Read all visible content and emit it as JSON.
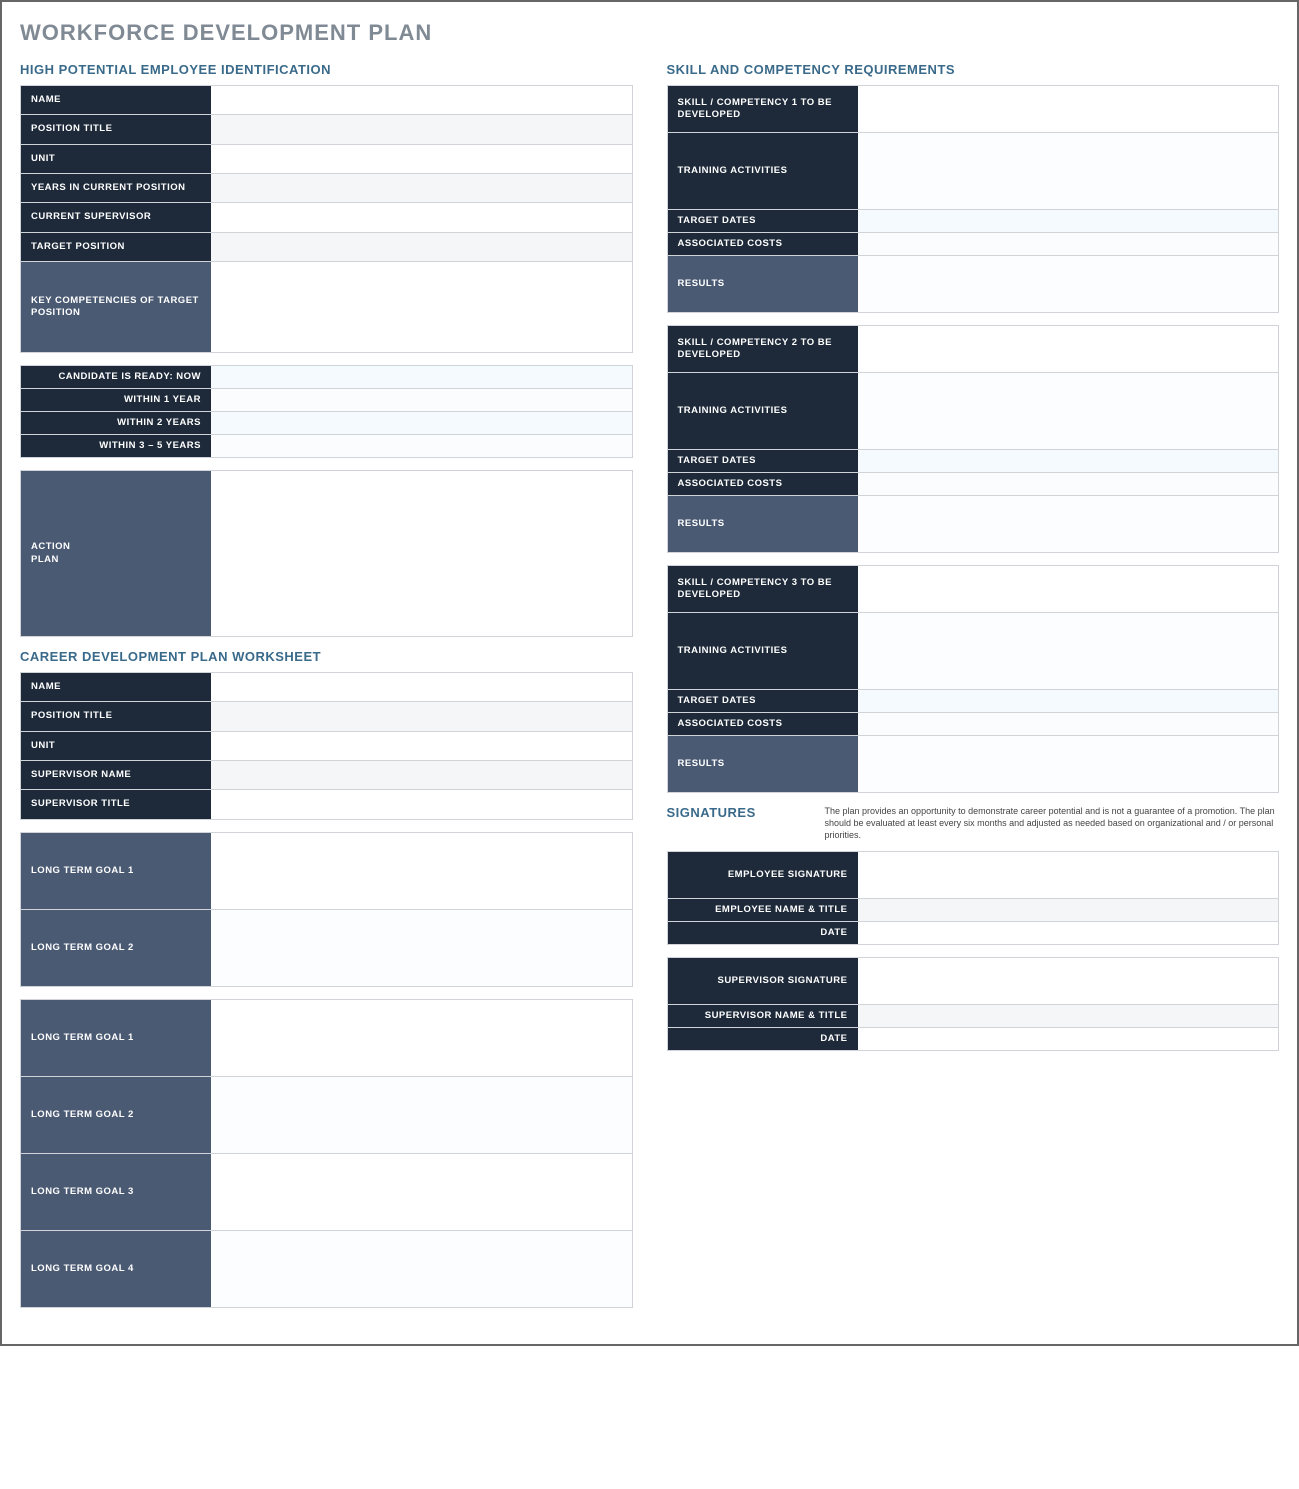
{
  "title": "WORKFORCE DEVELOPMENT PLAN",
  "left": {
    "hp_heading": "HIGH POTENTIAL EMPLOYEE IDENTIFICATION",
    "hp": {
      "name": "NAME",
      "position_title": "POSITION TITLE",
      "unit": "UNIT",
      "years": "YEARS IN CURRENT POSITION",
      "supervisor": "CURRENT SUPERVISOR",
      "target_position": "TARGET POSITION",
      "key_comp": "KEY COMPETENCIES OF TARGET POSITION"
    },
    "ready": {
      "now": "CANDIDATE IS READY:  NOW",
      "y1": "WITHIN 1 YEAR",
      "y2": "WITHIN 2 YEARS",
      "y35": "WITHIN 3 – 5 YEARS"
    },
    "action_plan": "ACTION\nPLAN",
    "cdp_heading": "CAREER DEVELOPMENT PLAN WORKSHEET",
    "cdp": {
      "name": "NAME",
      "position_title": "POSITION TITLE",
      "unit": "UNIT",
      "sup_name": "SUPERVISOR NAME",
      "sup_title": "SUPERVISOR TITLE"
    },
    "ltg_a": {
      "g1": "LONG TERM GOAL 1",
      "g2": "LONG TERM GOAL 2"
    },
    "ltg_b": {
      "g1": "LONG TERM GOAL 1",
      "g2": "LONG TERM GOAL 2",
      "g3": "LONG TERM GOAL 3",
      "g4": "LONG TERM GOAL 4"
    }
  },
  "right": {
    "skill_heading": "SKILL AND COMPETENCY REQUIREMENTS",
    "skill_labels": {
      "training": "TRAINING ACTIVITIES",
      "dates": "TARGET DATES",
      "costs": "ASSOCIATED COSTS",
      "results": "RESULTS"
    },
    "skills": [
      "SKILL / COMPETENCY 1 TO BE DEVELOPED",
      "SKILL / COMPETENCY 2 TO BE DEVELOPED",
      "SKILL / COMPETENCY 3 TO BE DEVELOPED"
    ],
    "sig_heading": "SIGNATURES",
    "sig_note": "The plan provides an opportunity to demonstrate career potential and is not a guarantee of a promotion. The plan should be evaluated at least every six months and adjusted as needed based on organizational and / or personal priorities.",
    "sig_emp": {
      "sig": "EMPLOYEE SIGNATURE",
      "name": "EMPLOYEE NAME & TITLE",
      "date": "DATE"
    },
    "sig_sup": {
      "sig": "SUPERVISOR SIGNATURE",
      "name": "SUPERVISOR NAME & TITLE",
      "date": "DATE"
    }
  }
}
